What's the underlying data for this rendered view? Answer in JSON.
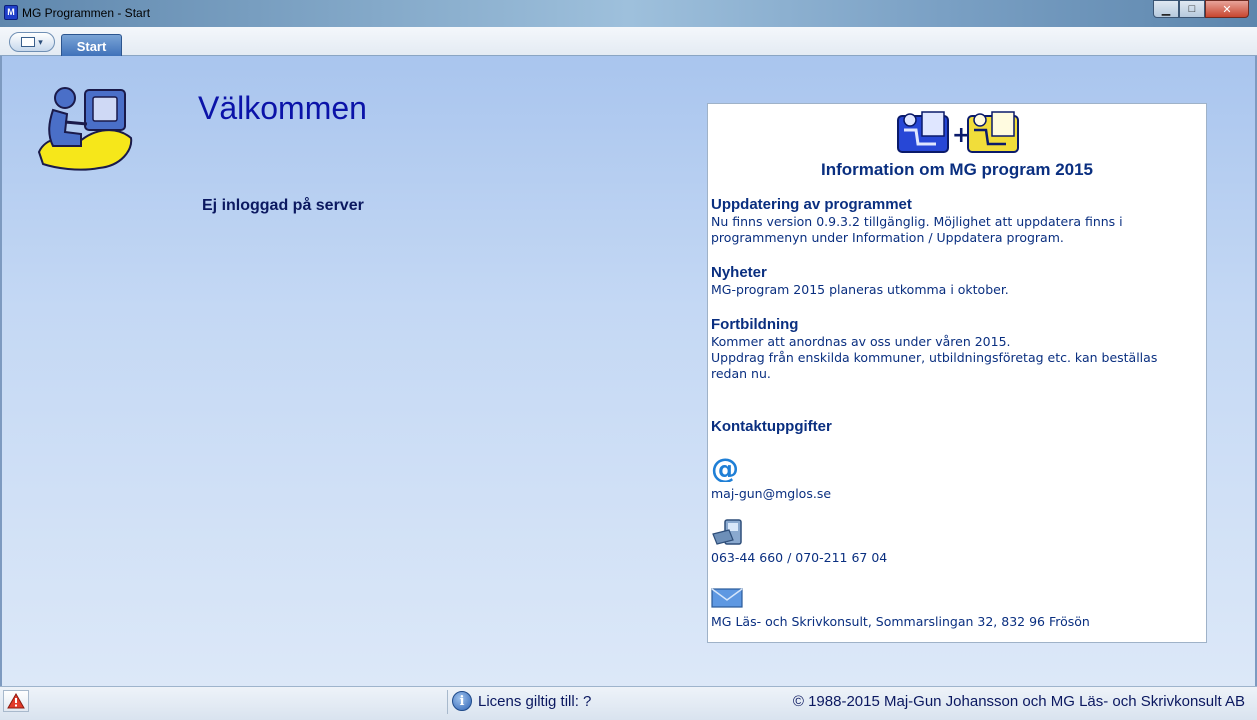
{
  "window": {
    "title": "MG Programmen - Start",
    "minimize_glyph": "▁",
    "maximize_glyph": "□",
    "close_glyph": "✕"
  },
  "tabs": [
    {
      "label": "Start",
      "active": true
    }
  ],
  "main": {
    "welcome": "Välkommen",
    "login_status": "Ej inloggad på server"
  },
  "info": {
    "title": "Information om MG program 2015",
    "sections": [
      {
        "heading": "Uppdatering av programmet",
        "lines": [
          "Nu finns version 0.9.3.2 tillgänglig. Möjlighet att uppdatera finns i",
          "programmenyn under Information / Uppdatera program."
        ]
      },
      {
        "heading": "Nyheter",
        "lines": [
          "MG-program 2015 planeras utkomma i oktober."
        ]
      },
      {
        "heading": "Fortbildning",
        "lines": [
          "Kommer att anordnas av oss under våren 2015.",
          "Uppdrag från enskilda kommuner, utbildningsföretag etc. kan beställas",
          "redan nu."
        ]
      }
    ],
    "contact": {
      "heading": "Kontaktuppgifter",
      "email": "maj-gun@mglos.se",
      "phone": "063-44 660 / 070-211 67 04",
      "address": "MG Läs- och Skrivkonsult, Sommarslingan 32, 832 96 Frösön"
    }
  },
  "status": {
    "license": "Licens giltig till: ?",
    "copyright": "© 1988-2015 Maj-Gun Johansson och MG Läs- och Skrivkonsult AB"
  },
  "colors": {
    "accent": "#0b13a8",
    "panel_text": "#0a2f80",
    "background_top": "#a9c5ee",
    "background_bottom": "#dce8f8"
  },
  "icons": {
    "app": "mg-app-icon",
    "menu": "app-menu-icon",
    "logo": "person-at-computer-logo",
    "info_logo": "two-persons-plus-logo",
    "email": "at-sign-icon",
    "phone": "phone-icon",
    "mail": "envelope-icon",
    "warning": "warning-triangle-icon",
    "info": "info-icon"
  }
}
